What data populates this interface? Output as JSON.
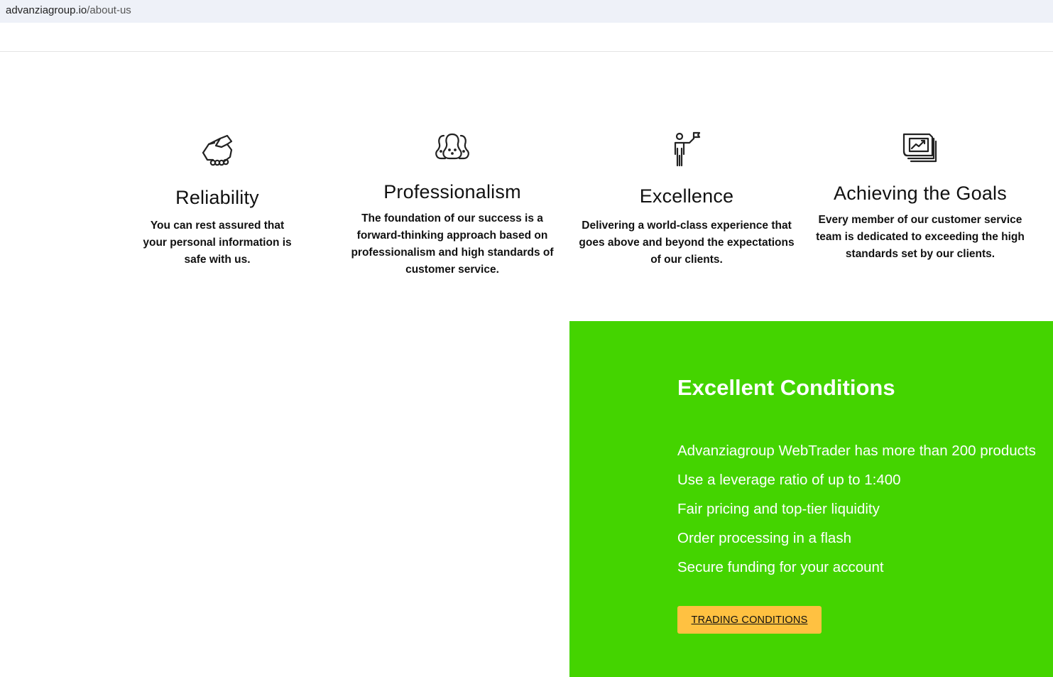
{
  "browser": {
    "url_domain": "advanziagroup.io",
    "url_path": "/about-us"
  },
  "features": [
    {
      "icon": "handshake-icon",
      "title": "Reliability",
      "text": "You can rest assured that your personal information is safe with us."
    },
    {
      "icon": "team-icon",
      "title": "Professionalism",
      "text": "The foundation of our success is a forward-thinking approach based on professionalism and high standards of customer service."
    },
    {
      "icon": "person-flag-icon",
      "title": "Excellence",
      "text": "Delivering a world-class experience that goes above and beyond the expectations of our clients."
    },
    {
      "icon": "growth-chart-icon",
      "title": "Achieving the Goals",
      "text": "Every member of our customer service team is dedicated to exceeding the high standards set by our clients."
    }
  ],
  "conditions": {
    "title": "Excellent Conditions",
    "items": [
      "Advanziagroup WebTrader has more than 200 products",
      "Use a leverage ratio of up to 1:400",
      "Fair pricing and top-tier liquidity",
      "Order processing in a flash",
      "Secure funding for your account"
    ],
    "button_label": "TRADING CONDITIONS"
  },
  "colors": {
    "panel_green": "#44d400",
    "button_yellow": "#ffc141",
    "urlbar_bg": "#eef1f8"
  }
}
